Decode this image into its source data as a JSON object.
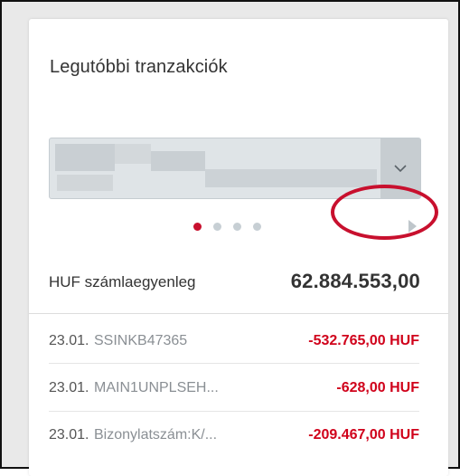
{
  "widget": {
    "title": "Legutóbbi tranzakciók",
    "account_select": {
      "value": "",
      "arrow_icon": "chevron-down-icon"
    },
    "pager": {
      "pages": 4,
      "active_index": 0,
      "next_icon": "triangle-right-icon"
    },
    "balance": {
      "label": "HUF számlaegyenleg",
      "value": "62.884.553,00"
    },
    "transactions": [
      {
        "date": "23.01.",
        "reference": "SSINKB47365",
        "amount": "-532.765,00 HUF"
      },
      {
        "date": "23.01.",
        "reference": "MAIN1UNPLSEH...",
        "amount": "-628,00 HUF"
      },
      {
        "date": "23.01.",
        "reference": "Bizonylatszám:K/...",
        "amount": "-209.467,00 HUF"
      }
    ]
  },
  "colors": {
    "accent_red": "#c8102e",
    "amount_red": "#d0021b",
    "dot_inactive": "#c7cfd4",
    "select_bg": "#dfe4e7"
  }
}
